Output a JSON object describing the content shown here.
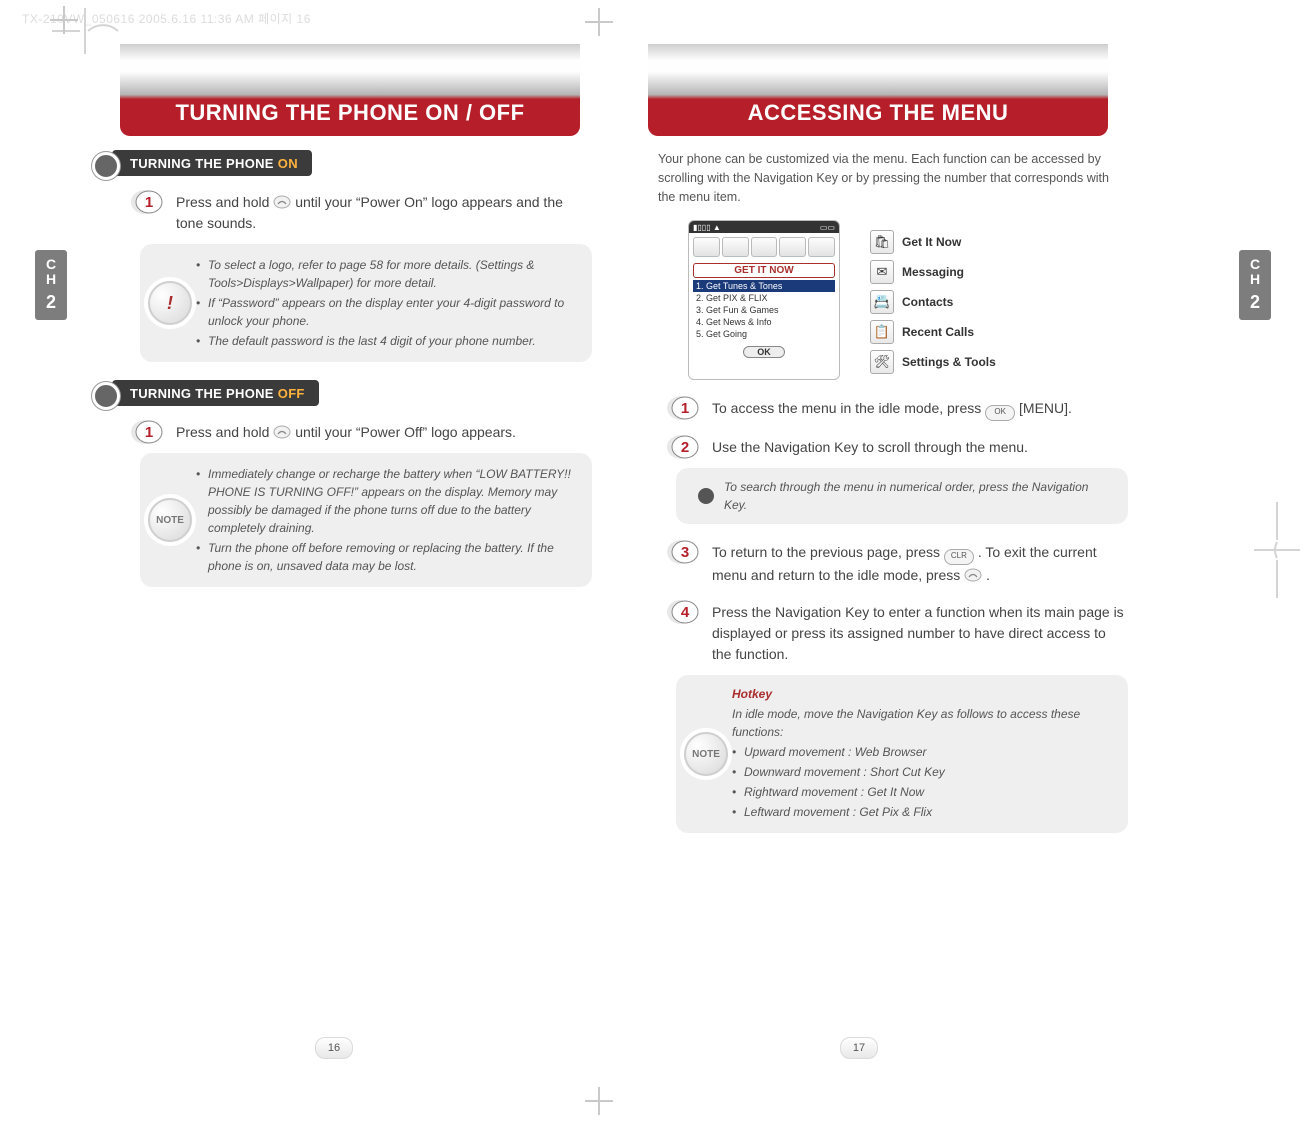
{
  "meta": {
    "header_text": "TX-210VW_050616  2005.6.16 11:36 AM  페이지 16"
  },
  "banner": {
    "left_title": "TURNING THE PHONE ON / OFF",
    "right_title": "ACCESSING THE MENU"
  },
  "spine": {
    "letters": "CH",
    "number": "2"
  },
  "left_page": {
    "sec_on": {
      "label_main": "TURNING THE PHONE",
      "label_accent": "ON"
    },
    "sec_on_step1_a": "Press and hold ",
    "sec_on_step1_b": " until your “Power On” logo appears and the tone sounds.",
    "sec_on_notes": [
      "To select a logo, refer to page 58 for more details. (Settings & Tools>Displays>Wallpaper) for more detail.",
      "If “Password” appears on the display enter your 4-digit password to unlock your phone.",
      "The default password is the last 4 digit of your  phone number."
    ],
    "sec_off": {
      "label_main": "TURNING THE PHONE",
      "label_accent": "OFF"
    },
    "sec_off_step1_a": "Press and hold ",
    "sec_off_step1_b": " until your “Power Off” logo appears.",
    "sec_off_notes": [
      "Immediately change or recharge the battery when “LOW BATTERY!! PHONE IS TURNING OFF!” appears on the display. Memory may possibly be damaged if the phone turns off due to the battery completely draining.",
      "Turn the phone off before removing or replacing the battery. If the phone is on, unsaved data may be lost."
    ],
    "note_badge": "NOTE",
    "page_number": "16"
  },
  "right_page": {
    "intro": "Your phone can be customized via the menu. Each function can be accessed by scrolling with the Navigation Key or by pressing the number that corresponds with the menu item.",
    "phone_screen": {
      "title": "GET IT NOW",
      "items": [
        "1. Get Tunes & Tones",
        "2. Get PIX & FLIX",
        "3. Get Fun & Games",
        "4. Get News & Info",
        "5. Get Going"
      ],
      "softkey": "OK"
    },
    "menu_items": [
      {
        "icon": "🛍",
        "label": "Get It Now"
      },
      {
        "icon": "✉",
        "label": "Messaging"
      },
      {
        "icon": "📇",
        "label": "Contacts"
      },
      {
        "icon": "📋",
        "label": "Recent Calls"
      },
      {
        "icon": "🛠",
        "label": "Settings & Tools"
      }
    ],
    "step1_a": "To access the menu in the idle mode, press ",
    "step1_key": "OK",
    "step1_b": " [MENU].",
    "step2": "Use the Navigation Key to scroll through the menu.",
    "step2_tip": "To search through the menu in numerical order, press the Navigation Key.",
    "step3_a": "To return to the previous page, press ",
    "step3_key": "CLR",
    "step3_b": ". To exit the current menu and return to the idle mode, press ",
    "step3_c": " .",
    "step4": "Press the Navigation Key to enter a function when its main page is displayed or press its assigned number to have direct access to the function.",
    "hotkey_heading": "Hotkey",
    "hotkey_intro": "In idle mode, move the Navigation Key as follows to access these functions:",
    "hotkey_list": [
      "Upward movement : Web Browser",
      "Downward movement : Short Cut Key",
      "Rightward movement : Get It Now",
      "Leftward movement : Get Pix & Flix"
    ],
    "note_badge": "NOTE",
    "page_number": "17"
  }
}
